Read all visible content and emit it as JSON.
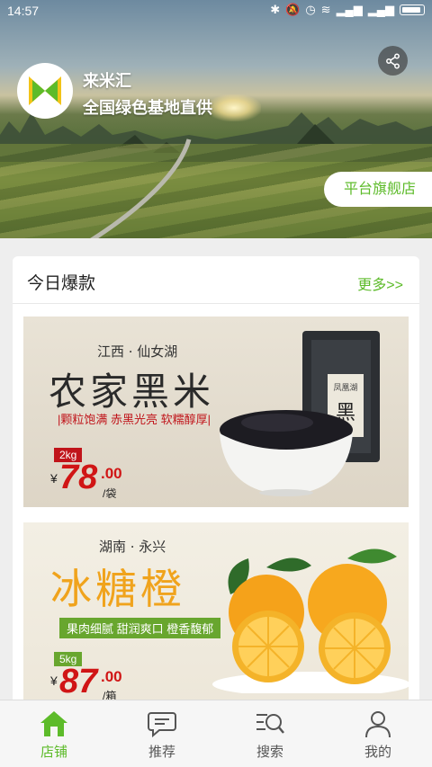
{
  "status_bar": {
    "time": "14:57",
    "icons": [
      "bluetooth-icon",
      "mute-icon",
      "alarm-icon",
      "wifi-icon",
      "signal-icon",
      "signal-icon",
      "battery-icon"
    ]
  },
  "shop": {
    "name": "来米汇",
    "slogan": "全国绿色基地直供",
    "flagship_label": "平台旗舰店",
    "share_icon": "share-icon"
  },
  "section": {
    "title": "今日爆款",
    "more": "更多>>"
  },
  "products": [
    {
      "origin": "江西 · 仙女湖",
      "title": "农家黑米",
      "features": "|颗粒饱满 赤黑光亮 软糯醇厚|",
      "weight": "2kg",
      "currency": "¥",
      "price_int": "78",
      "price_dec": ".00",
      "unit": "/袋",
      "title_color": "#2a2a2a",
      "weight_bg": "#c0141a",
      "pack_text": "凤凰湖"
    },
    {
      "origin": "湖南 · 永兴",
      "title": "冰糖橙",
      "features": "果肉细腻 甜润爽口 橙香馥郁",
      "weight": "5kg",
      "currency": "¥",
      "price_int": "87",
      "price_dec": ".00",
      "unit": "/箱",
      "title_color": "#f0a31c",
      "weight_bg": "#68a62e"
    }
  ],
  "bottom_nav": [
    {
      "label": "店铺",
      "icon": "home-icon",
      "active": true
    },
    {
      "label": "推荐",
      "icon": "chat-icon",
      "active": false
    },
    {
      "label": "搜索",
      "icon": "search-icon",
      "active": false
    },
    {
      "label": "我的",
      "icon": "user-icon",
      "active": false
    }
  ],
  "colors": {
    "accent": "#5dbb2a",
    "price": "#d01515"
  }
}
